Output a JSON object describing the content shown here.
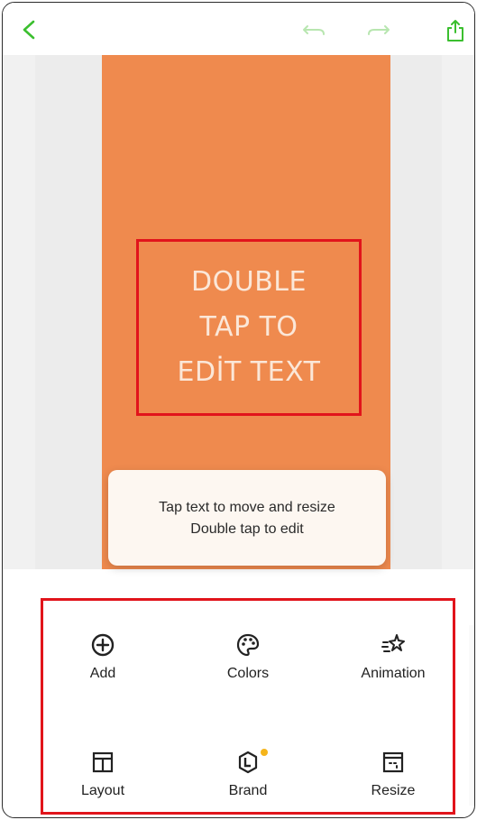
{
  "header": {
    "back_icon": "chevron-left-icon",
    "undo_icon": "undo-icon",
    "redo_icon": "redo-icon",
    "share_icon": "share-icon",
    "accent_color": "#3bbf2f",
    "disabled_color": "#b8e6b0"
  },
  "canvas": {
    "background_color": "#ef8a4e",
    "text_lines": [
      "DOUBLE",
      "TAP TO",
      "EDİT TEXT"
    ]
  },
  "tooltip": {
    "line1": "Tap text to move and resize",
    "line2": "Double tap to edit"
  },
  "toolbar": {
    "items": [
      {
        "label": "Add",
        "icon": "plus-circle-icon"
      },
      {
        "label": "Colors",
        "icon": "palette-icon"
      },
      {
        "label": "Animation",
        "icon": "sparkle-icon"
      },
      {
        "label": "Layout",
        "icon": "layout-grid-icon"
      },
      {
        "label": "Brand",
        "icon": "brand-hexagon-icon"
      },
      {
        "label": "Resize",
        "icon": "resize-icon"
      }
    ]
  }
}
